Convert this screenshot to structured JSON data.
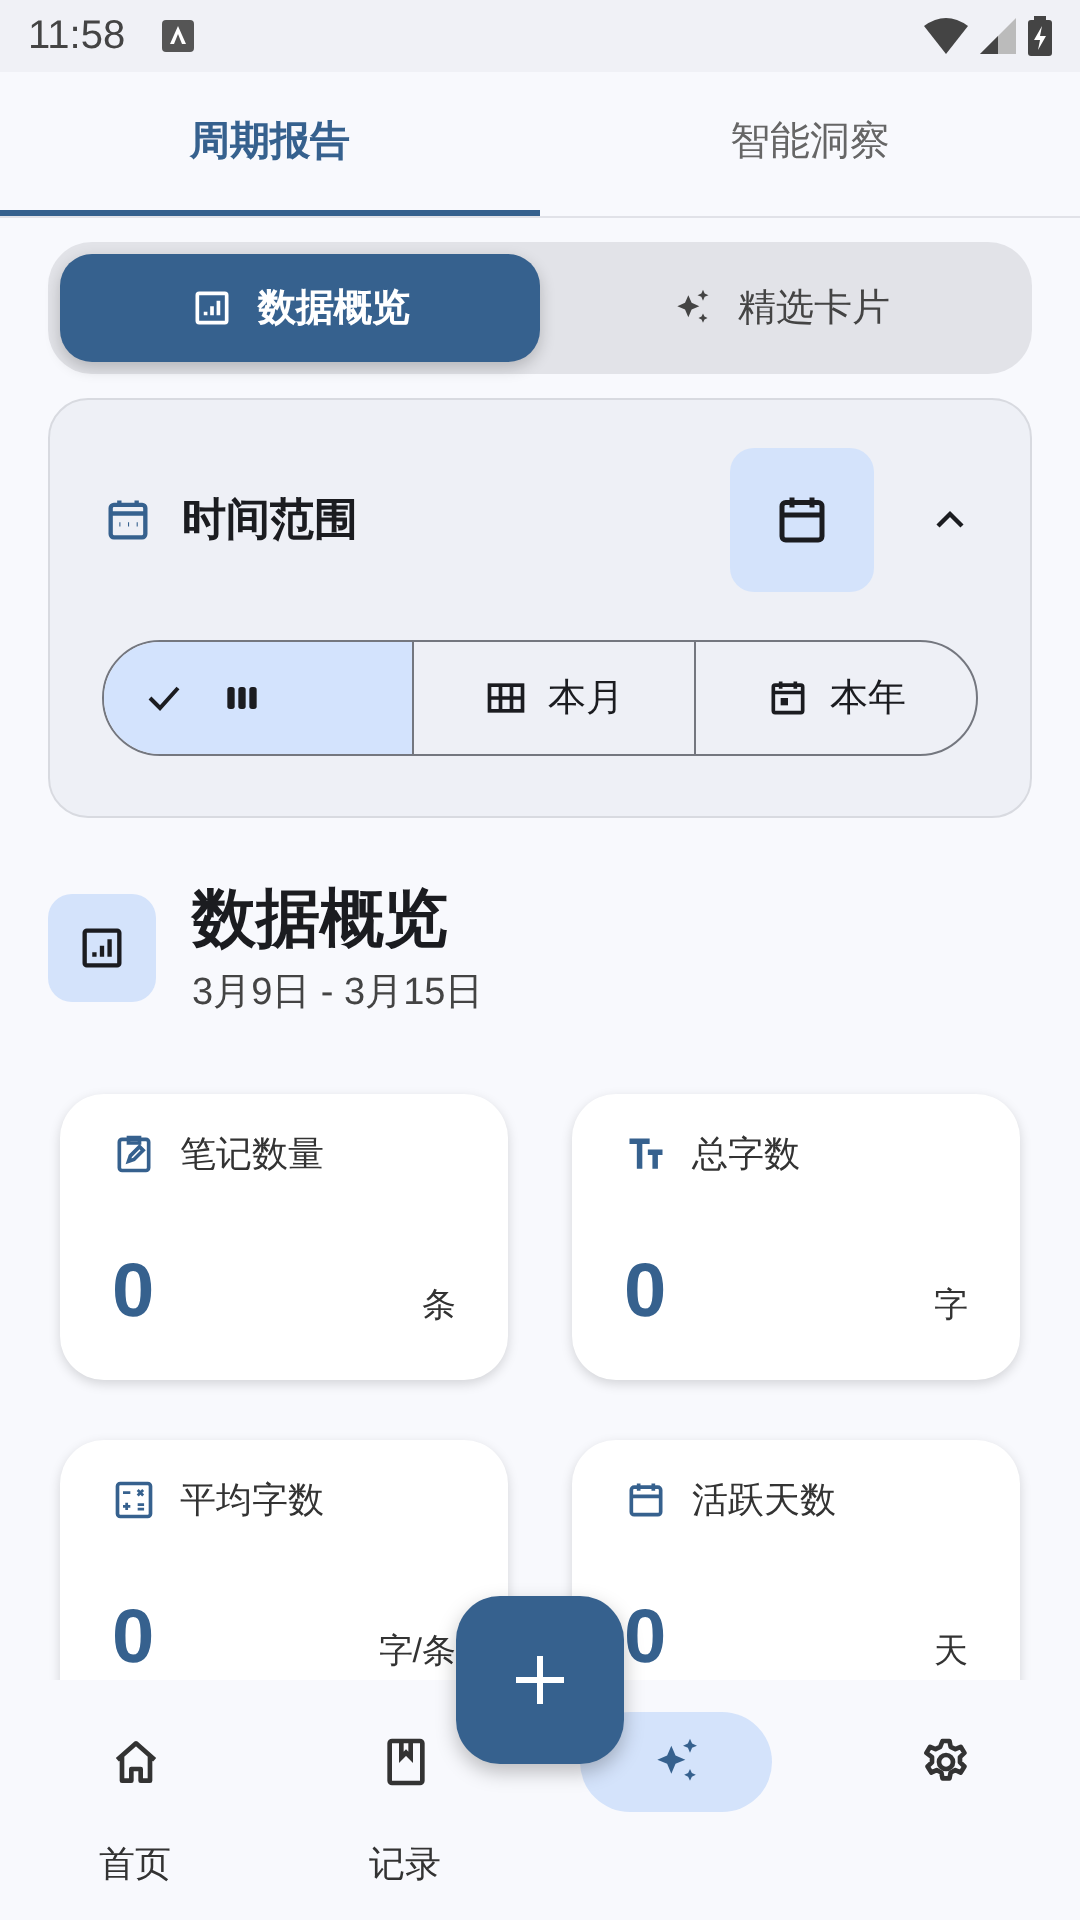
{
  "status_bar": {
    "time": "11:58"
  },
  "tabs": [
    {
      "label": "周期报告",
      "selected": true
    },
    {
      "label": "智能洞察",
      "selected": false
    }
  ],
  "view_switch": [
    {
      "kind": "chart",
      "label": "数据概览",
      "selected": true
    },
    {
      "kind": "sparkle",
      "label": "精选卡片",
      "selected": false
    }
  ],
  "time_range": {
    "title": "时间范围",
    "expanded": true,
    "options": [
      {
        "kind": "week",
        "selected": true
      },
      {
        "kind": "month",
        "label": "本月",
        "selected": false
      },
      {
        "kind": "year",
        "label": "本年",
        "selected": false
      }
    ]
  },
  "overview": {
    "title": "数据概览",
    "date_range": "3月9日 - 3月15日"
  },
  "stats": [
    {
      "kind": "note",
      "label": "笔记数量",
      "value": "0",
      "unit": "条"
    },
    {
      "kind": "text",
      "label": "总字数",
      "value": "0",
      "unit": "字"
    },
    {
      "kind": "calc",
      "label": "平均字数",
      "value": "0",
      "unit": "字/条"
    },
    {
      "kind": "calendar",
      "label": "活跃天数",
      "value": "0",
      "unit": "天"
    }
  ],
  "nav": [
    {
      "kind": "home",
      "label": "首页",
      "selected": false
    },
    {
      "kind": "book",
      "label": "记录",
      "selected": false
    },
    {
      "kind": "sparkle",
      "selected": true
    },
    {
      "kind": "gear",
      "selected": false
    }
  ]
}
